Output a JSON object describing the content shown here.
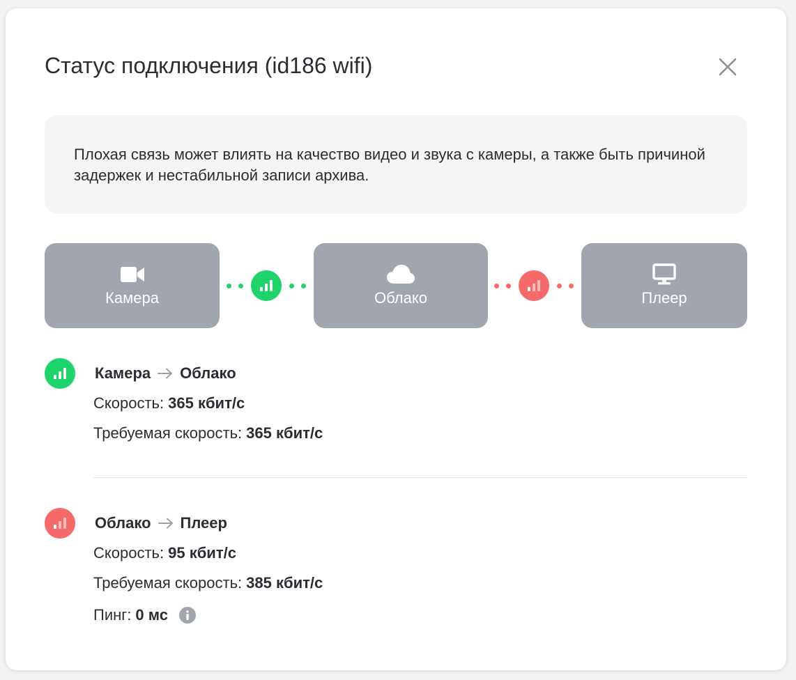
{
  "modal": {
    "title": "Статус подключения (id186 wifi)",
    "close_icon": "close-icon"
  },
  "notice": {
    "text": "Плохая связь может влиять на качество видео и звука с камеры, а также быть причиной задержек и нестабильной записи архива."
  },
  "diagram": {
    "nodes": [
      {
        "label": "Камера",
        "icon": "camera-icon"
      },
      {
        "label": "Облако",
        "icon": "cloud-icon"
      },
      {
        "label": "Плеер",
        "icon": "monitor-icon"
      }
    ],
    "links": [
      {
        "status": "good",
        "color": "#1fd36b",
        "icon": "signal-bars-icon"
      },
      {
        "status": "bad",
        "color": "#f76a6a",
        "icon": "signal-bars-icon"
      }
    ]
  },
  "routes": [
    {
      "from": "Камера",
      "to": "Облако",
      "status_color": "#1fd36b",
      "speed_label": "Скорость:",
      "speed_value": "365 кбит/с",
      "required_label": "Требуемая скорость:",
      "required_value": "365 кбит/с"
    },
    {
      "from": "Облако",
      "to": "Плеер",
      "status_color": "#f76a6a",
      "speed_label": "Скорость:",
      "speed_value": "95 кбит/с",
      "required_label": "Требуемая скорость:",
      "required_value": "385 кбит/с",
      "ping_label": "Пинг:",
      "ping_value": "0 мс",
      "info_icon": "info-icon"
    }
  ],
  "colors": {
    "good": "#1fd36b",
    "bad": "#f76a6a",
    "node_bg": "#a1a5ad",
    "notice_bg": "#f5f5f5"
  }
}
